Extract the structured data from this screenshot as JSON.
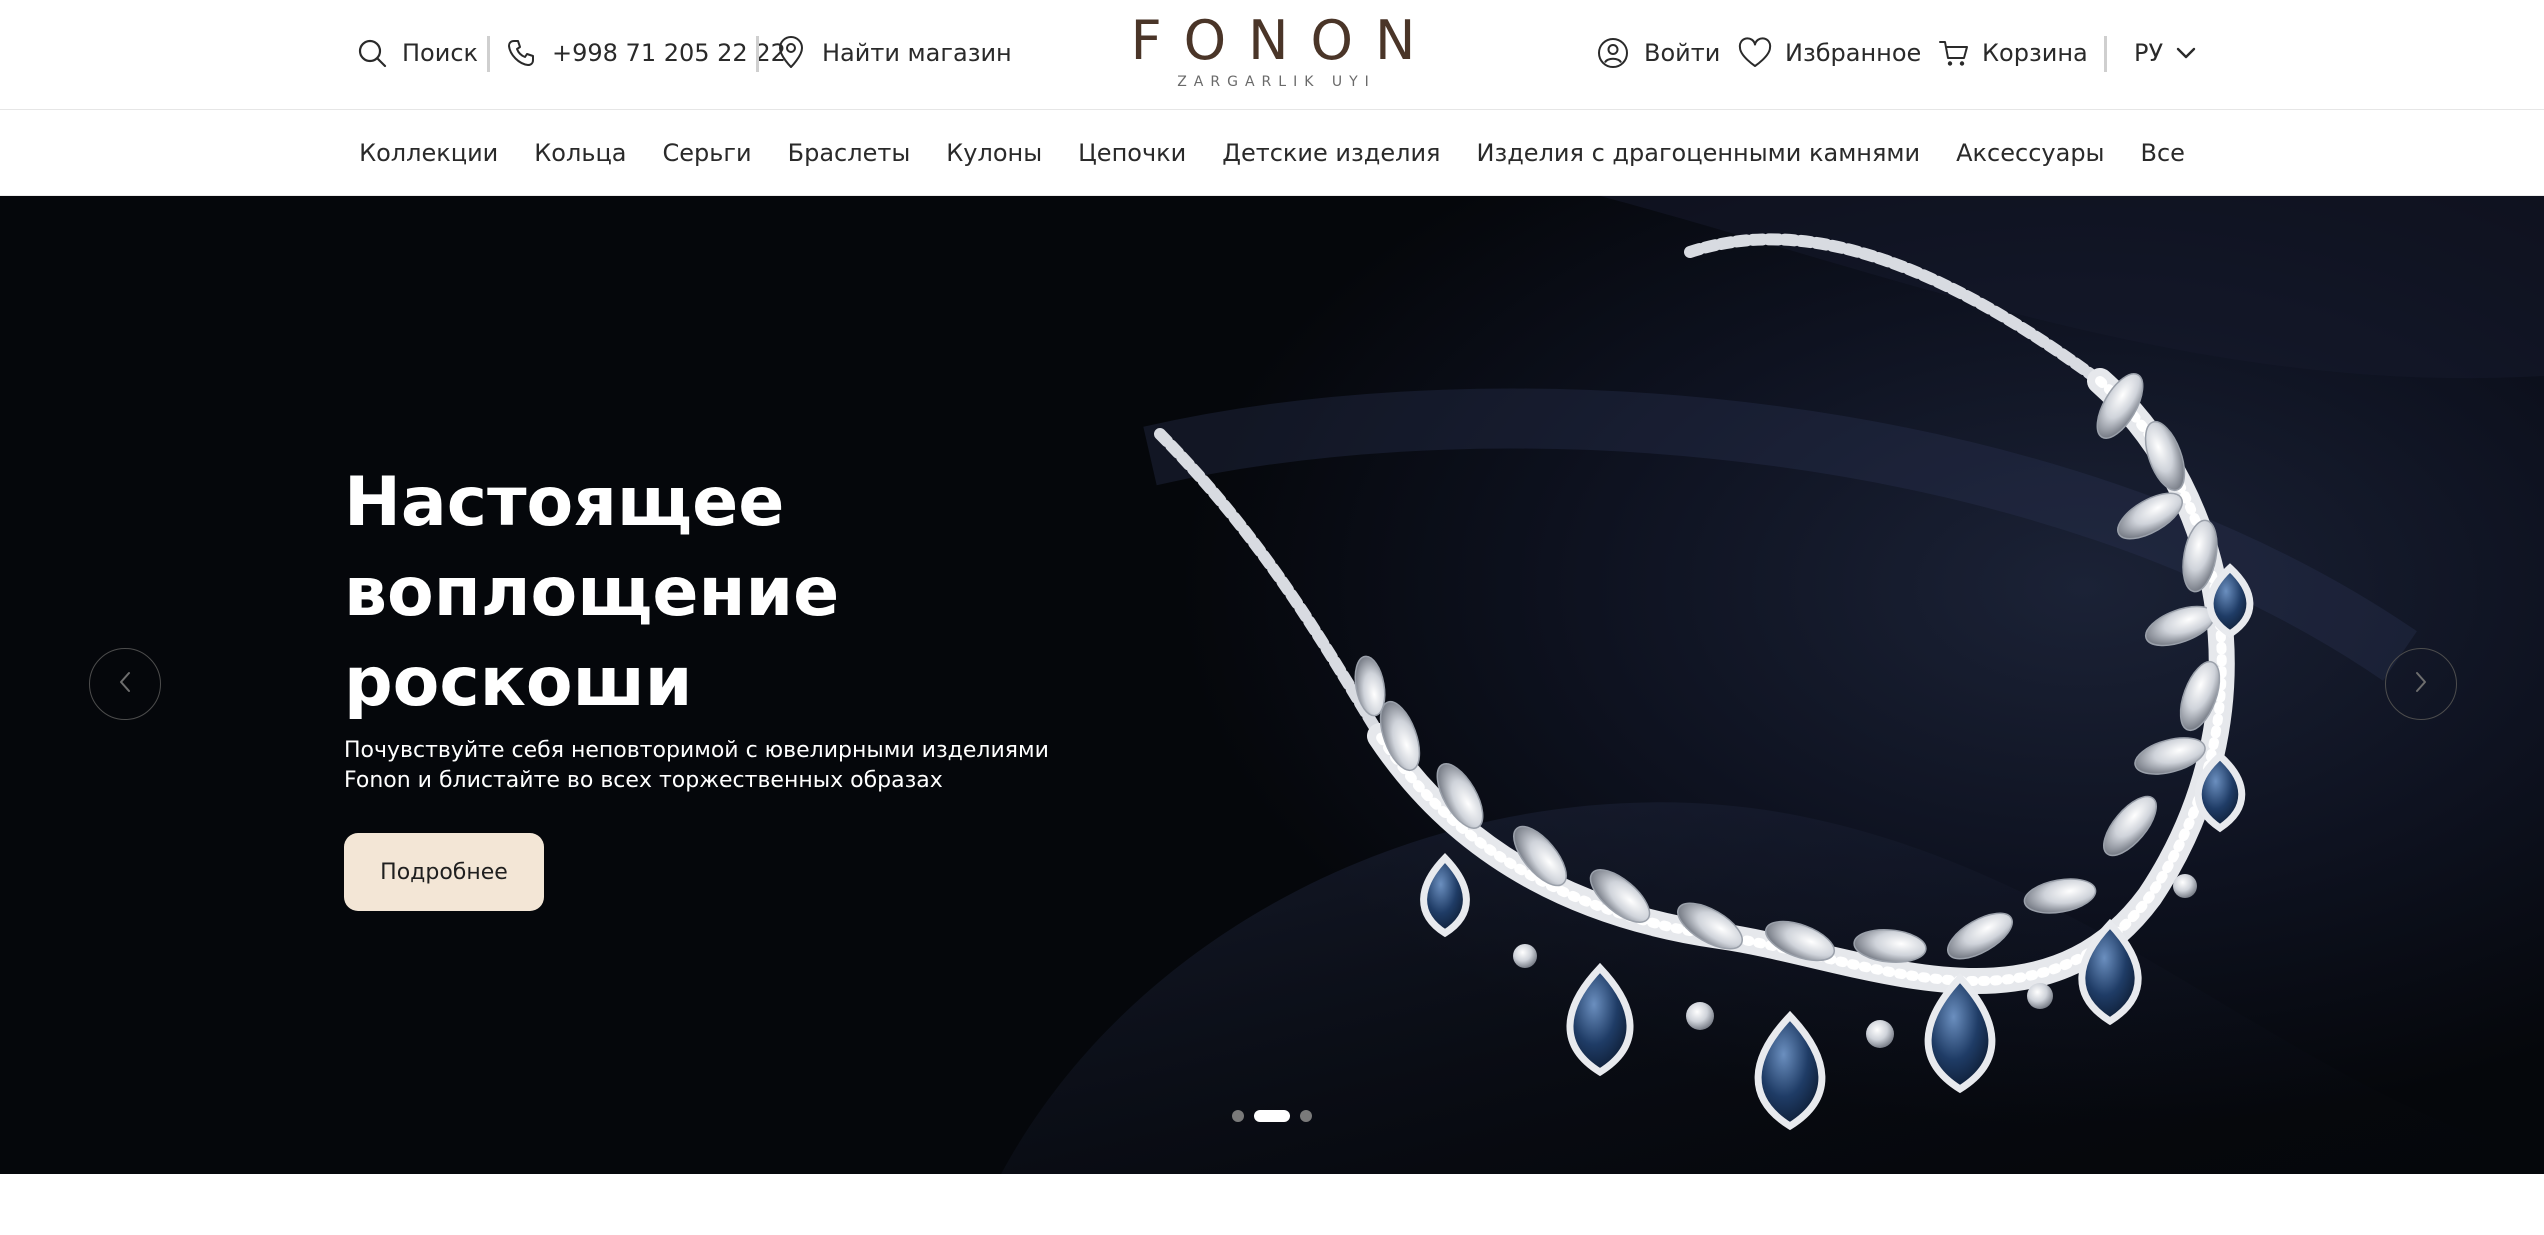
{
  "header": {
    "search_label": "Поиск",
    "phone": "+998 71 205 22 22",
    "find_store_label": "Найти магазин",
    "logo_text": "FONON",
    "logo_sub": "ZARGARLIK UYI",
    "login_label": "Войти",
    "favorites_label": "Избранное",
    "cart_label": "Корзина",
    "language": "РУ"
  },
  "nav": {
    "items": [
      {
        "label": "Коллекции"
      },
      {
        "label": "Кольца"
      },
      {
        "label": "Серьги"
      },
      {
        "label": "Браслеты"
      },
      {
        "label": "Кулоны"
      },
      {
        "label": "Цепочки"
      },
      {
        "label": "Детские изделия"
      },
      {
        "label": "Изделия с драгоценными камнями"
      },
      {
        "label": "Аксессуары"
      },
      {
        "label": "Все"
      }
    ]
  },
  "hero": {
    "title_line1": "Настоящее",
    "title_line2": "воплощение",
    "title_line3": "роскоши",
    "subtitle_line1": "Почувствуйте себя неповторимой с ювелирными изделиями",
    "subtitle_line2": "Fonon и блистайте во всех торжественных образах",
    "cta_label": "Подробнее",
    "slides_total": 3,
    "active_slide": 2
  },
  "colors": {
    "logo": "#4a3528",
    "cta_bg": "#f3e6d6",
    "hero_bg": "#06080c",
    "text": "#2a2a2a"
  },
  "icons": {
    "search": "search-icon",
    "phone": "phone-icon",
    "store": "location-pin-icon",
    "login": "user-circle-icon",
    "favorites": "heart-icon",
    "cart": "cart-icon",
    "language": "chevron-down-icon",
    "prev": "chevron-left-icon",
    "next": "chevron-right-icon"
  }
}
